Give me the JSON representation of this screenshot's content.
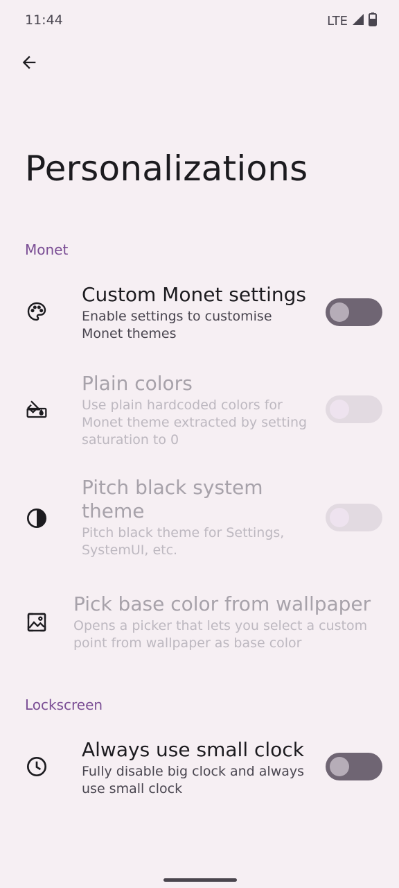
{
  "status": {
    "time": "11:44",
    "network": "LTE"
  },
  "page": {
    "title": "Personalizations"
  },
  "sections": {
    "monet": {
      "header": "Monet"
    },
    "lockscreen": {
      "header": "Lockscreen"
    }
  },
  "items": {
    "custom_monet": {
      "title": "Custom Monet settings",
      "summary": "Enable settings to customise Monet themes",
      "enabled": true,
      "checked": false,
      "icon": "palette-icon"
    },
    "plain_colors": {
      "title": "Plain colors",
      "summary": "Use plain hardcoded colors for Monet theme extracted by setting saturation to 0",
      "enabled": false,
      "checked": false,
      "icon": "paint-bucket-icon"
    },
    "pitch_black": {
      "title": "Pitch black system theme",
      "summary": "Pitch black theme for Settings, SystemUI, etc.",
      "enabled": false,
      "checked": false,
      "icon": "contrast-icon"
    },
    "pick_base_color": {
      "title": "Pick base color from wallpaper",
      "summary": "Opens a picker that lets you select a custom point from wallpaper as base color",
      "enabled": false,
      "icon": "image-icon"
    },
    "small_clock": {
      "title": "Always use small clock",
      "summary": "Fully disable big clock and always use small clock",
      "enabled": true,
      "checked": false,
      "icon": "clock-icon"
    }
  },
  "colors": {
    "background": "#f6eff3",
    "accent": "#7a4d94",
    "switch_track_off": "#6f6573",
    "switch_track_disabled": "#e2dae1"
  }
}
